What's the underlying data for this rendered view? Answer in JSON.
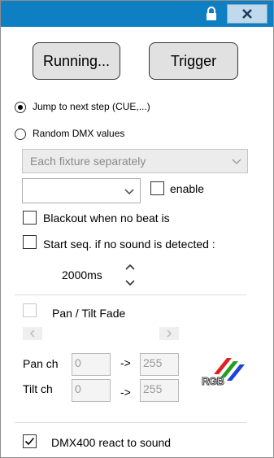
{
  "titlebar": {
    "lock_icon": "lock-icon",
    "close_icon": "close-icon"
  },
  "buttons": {
    "running": "Running...",
    "trigger": "Trigger"
  },
  "mode": {
    "jump_label": "Jump to next step (CUE,...)",
    "random_label": "Random DMX values",
    "selected": "jump"
  },
  "fixture_select": {
    "value": "Each fixture separately"
  },
  "enable": {
    "label": "enable",
    "checked": false
  },
  "blackout": {
    "label": "Blackout when no beat is",
    "checked": false
  },
  "start_seq": {
    "label": "Start seq. if no sound is detected :",
    "checked": false
  },
  "timeout": {
    "value": "2000ms"
  },
  "pan_tilt": {
    "label": "Pan / Tilt Fade",
    "checked": false
  },
  "pan": {
    "label": "Pan ch",
    "from": "0",
    "arrow": "->",
    "to": "255"
  },
  "tilt": {
    "label": "Tilt ch",
    "from": "0",
    "arrow": "->",
    "to": "255"
  },
  "rgb_logo": "RGB",
  "dmx400": {
    "label": "DMX400 react to sound",
    "checked": true
  },
  "colors": {
    "titlebar": "#0f7fc4",
    "button_bg": "#e1e1e1",
    "disabled_text": "#8a8a8a"
  }
}
